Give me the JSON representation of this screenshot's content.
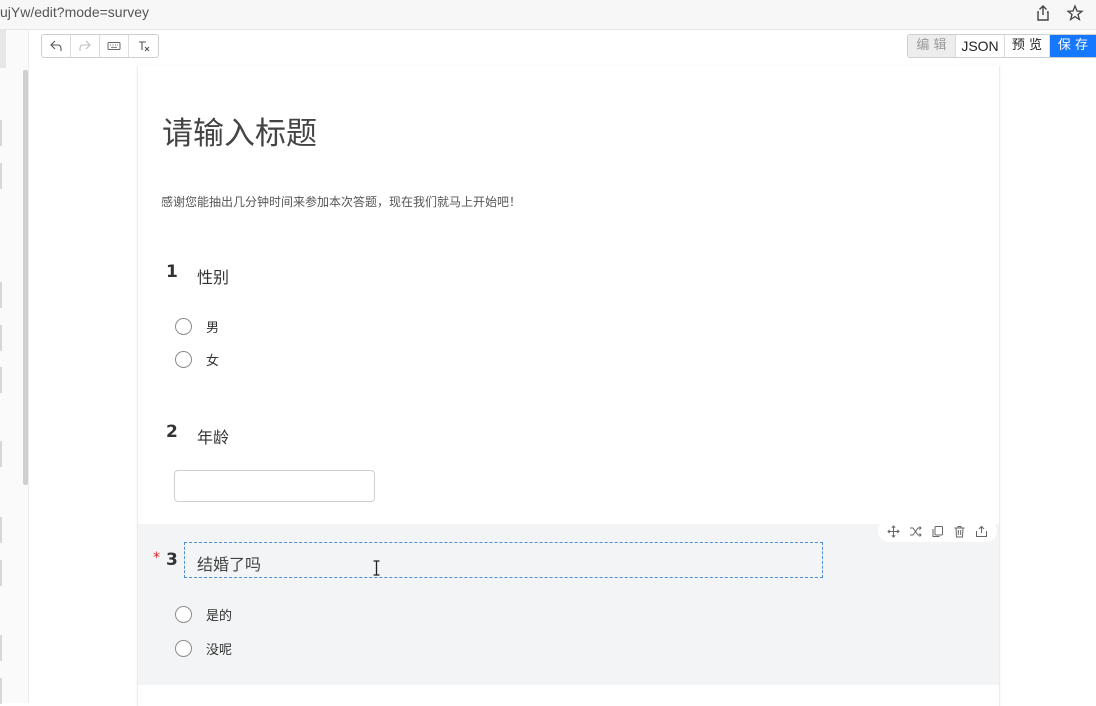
{
  "browser": {
    "address": "ujYw/edit?mode=survey"
  },
  "toolbar": {
    "undo_icon": "undo-icon",
    "redo_icon": "redo-icon",
    "keyboard_icon": "keyboard-icon",
    "clear_icon": "clear-format-icon",
    "edit_label": "编 辑",
    "json_label": "JSON",
    "preview_label": "预 览",
    "save_label": "保 存",
    "accent_color": "#1677ff"
  },
  "survey": {
    "title": "请输入标题",
    "description": "感谢您能抽出几分钟时间来参加本次答题，现在我们就马上开始吧！",
    "questions": [
      {
        "number": "1",
        "title": "性别",
        "options": [
          "男",
          "女"
        ]
      },
      {
        "number": "2",
        "title": "年龄"
      },
      {
        "number": "3",
        "required_mark": "*",
        "title": "结婚了吗",
        "options": [
          "是的",
          "没呢"
        ]
      }
    ]
  },
  "question_actions": [
    "move-icon",
    "shuffle-icon",
    "copy-icon",
    "delete-icon",
    "export-icon"
  ]
}
